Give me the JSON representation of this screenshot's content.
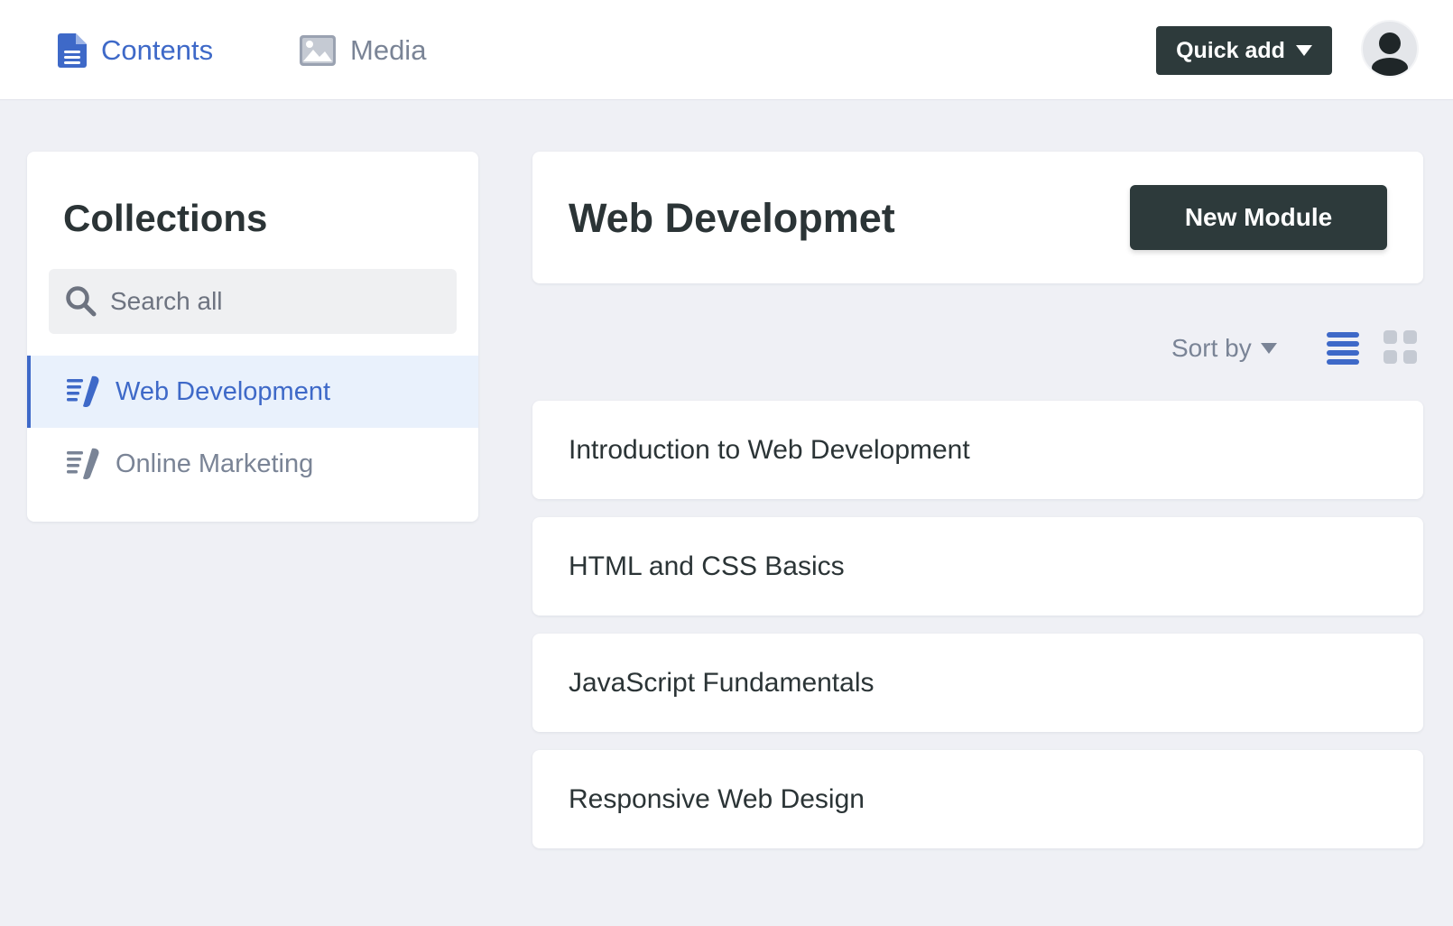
{
  "topbar": {
    "nav": [
      {
        "label": "Contents",
        "icon": "document-icon",
        "active": true
      },
      {
        "label": "Media",
        "icon": "image-icon",
        "active": false
      }
    ],
    "quick_add_label": "Quick add",
    "avatar_icon": "user-icon"
  },
  "collections": {
    "title": "Collections",
    "search_placeholder": "Search all",
    "items": [
      {
        "label": "Web Development",
        "active": true,
        "icon": "collection-icon"
      },
      {
        "label": "Online Marketing",
        "active": false,
        "icon": "collection-icon"
      }
    ]
  },
  "main": {
    "title": "Web Developmet",
    "new_module_label": "New Module",
    "sort_label": "Sort by",
    "view_mode": "list",
    "modules": [
      {
        "title": "Introduction to Web Development"
      },
      {
        "title": "HTML and CSS Basics"
      },
      {
        "title": "JavaScript Fundamentals"
      },
      {
        "title": "Responsive Web Design"
      }
    ]
  },
  "colors": {
    "accent": "#3e69c8",
    "dark_button": "#2d3a3b",
    "page_bg": "#eff0f5",
    "muted": "#7a8496"
  }
}
